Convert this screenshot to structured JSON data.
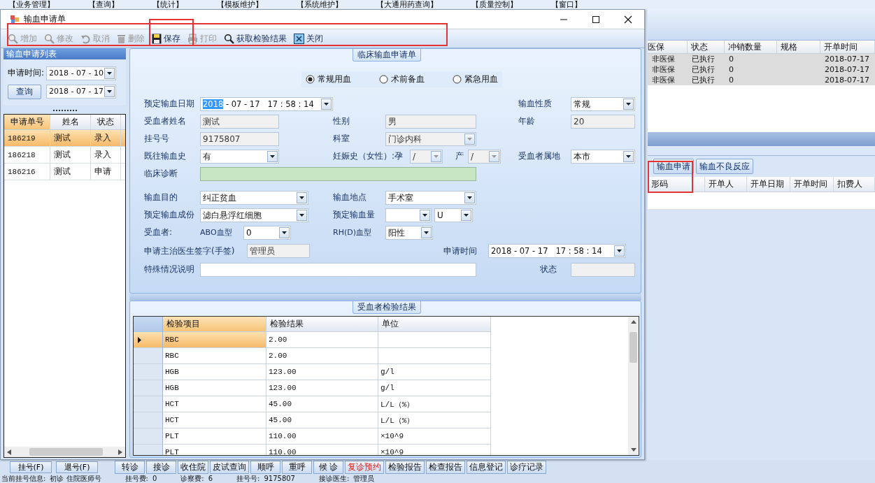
{
  "app": {
    "menu": [
      "【业务管理】",
      "【查询】",
      "【统计】",
      "【模板维护】",
      "【系统维护】",
      "【大通用药查询】",
      "【质量控制】",
      "【窗口】"
    ],
    "orders_table": {
      "columns": [
        "医保",
        "状态",
        "冲销数量",
        "规格",
        "开单时间"
      ],
      "rows": [
        {
          "insurance": "非医保",
          "status": "已执行",
          "writeoff_qty": "0",
          "time": "2018-07-17"
        },
        {
          "insurance": "非医保",
          "status": "已执行",
          "writeoff_qty": "0",
          "time": "2018-07-17"
        },
        {
          "insurance": "非医保",
          "status": "已执行",
          "writeoff_qty": "0",
          "time": "2018-07-17"
        }
      ]
    },
    "tab_buttons": [
      "输血申请",
      "输血不良反应"
    ],
    "detail_table": {
      "columns": [
        "形码",
        "开单人",
        "开单日期",
        "开单时间",
        "扣费人"
      ]
    },
    "left_buttons": [
      "挂号(F)",
      "退号(F)"
    ],
    "action_buttons": [
      {
        "label": "转诊",
        "emphasis": false
      },
      {
        "label": "接诊",
        "emphasis": false
      },
      {
        "label": "收住院",
        "emphasis": false
      },
      {
        "label": "皮试查询",
        "emphasis": false
      },
      {
        "label": "顺呼",
        "emphasis": false
      },
      {
        "label": "重呼",
        "emphasis": false
      },
      {
        "label": "候 诊",
        "emphasis": false
      },
      {
        "label": "复诊预约",
        "emphasis": true
      },
      {
        "label": "检验报告",
        "emphasis": false
      },
      {
        "label": "检查报告",
        "emphasis": false
      },
      {
        "label": "信息登记",
        "emphasis": false
      },
      {
        "label": "诊疗记录",
        "emphasis": false
      }
    ],
    "status_line": [
      {
        "label": "当前挂号信息:",
        "value": "初诊 住院医师号"
      },
      {
        "label": "挂号费:",
        "value": "0"
      },
      {
        "label": "诊察费:",
        "value": "6"
      },
      {
        "label": "挂号号:",
        "value": "9175807"
      },
      {
        "label": "接诊医生:",
        "value": "管理员"
      }
    ]
  },
  "dialog": {
    "title": "输血申请单",
    "toolbar": [
      {
        "label": "增加",
        "disabled": true
      },
      {
        "label": "修改",
        "disabled": true
      },
      {
        "label": "取消",
        "disabled": true
      },
      {
        "label": "删除",
        "disabled": true
      },
      {
        "label": "保存",
        "disabled": false
      },
      {
        "label": "打印",
        "disabled": true
      },
      {
        "label": "获取检验结果",
        "disabled": false
      },
      {
        "label": "关闭",
        "disabled": false
      }
    ],
    "list_panel": {
      "title": "输血申请列表",
      "date_label": "申请时间:",
      "date_from": "2018 - 07 - 10",
      "query_button": "查询",
      "date_to": "2018 - 07 - 17",
      "columns": [
        "申请单号",
        "姓名",
        "状态"
      ],
      "rows": [
        {
          "no": "186219",
          "name": "测试",
          "status": "录入",
          "selected": true
        },
        {
          "no": "186218",
          "name": "测试",
          "status": "录入",
          "selected": false
        },
        {
          "no": "186216",
          "name": "测试",
          "status": "申请",
          "selected": false
        }
      ]
    },
    "form": {
      "title": "临床输血申请单",
      "blood_use": [
        {
          "label": "常规用血",
          "selected": true
        },
        {
          "label": "术前备血",
          "selected": false
        },
        {
          "label": "紧急用血",
          "selected": false
        }
      ],
      "planned_date": {
        "label": "预定输血日期",
        "selected_part": "2018",
        "rest": "- 07 - 17   17 : 58 : 14",
        "disabled": false
      },
      "nature": {
        "label": "输血性质",
        "value": "常规",
        "disabled": false
      },
      "recipient_name": {
        "label": "受血者姓名",
        "value": "测试",
        "disabled": true
      },
      "gender": {
        "label": "性别",
        "value": "男",
        "disabled": true
      },
      "age": {
        "label": "年龄",
        "value": "20",
        "disabled": true
      },
      "registration_no": {
        "label": "挂号号",
        "value": "9175807",
        "disabled": true
      },
      "department": {
        "label": "科室",
        "value": "门诊内科",
        "disabled": true
      },
      "history": {
        "label": "既往输血史",
        "value": "有",
        "disabled": false
      },
      "pregnancy": {
        "label": "妊娠史（女性）:孕",
        "value": "/",
        "disabled": true
      },
      "birth": {
        "label": "产",
        "value": "/",
        "disabled": true
      },
      "residence": {
        "label": "受血者属地",
        "value": "本市",
        "disabled": false
      },
      "diagnosis": {
        "label": "临床诊断",
        "disabled": false,
        "highlighted": true
      },
      "purpose": {
        "label": "输血目的",
        "value": "纠正贫血",
        "disabled": false
      },
      "location": {
        "label": "输血地点",
        "value": "手术室",
        "disabled": false
      },
      "component": {
        "label": "预定输血成份",
        "value": "滤白悬浮红细胞",
        "disabled": false
      },
      "amount": {
        "label": "预定输血量",
        "disabled": false
      },
      "amount_unit": {
        "value": "U",
        "disabled": false
      },
      "recipient": {
        "label": "受血者:"
      },
      "abo": {
        "label": "ABO血型",
        "value": "0",
        "disabled": false
      },
      "rh": {
        "label": "RH(D)血型",
        "value": "阳性",
        "disabled": false
      },
      "doctor": {
        "label": "申请主治医生签字(手签)",
        "value": "管理员",
        "disabled": true
      },
      "apply_time": {
        "label": "申请时间",
        "value": "2018 - 07 - 17   17 : 58 : 14",
        "disabled": false
      },
      "special": {
        "label": "特殊情况说明",
        "disabled": false
      },
      "status": {
        "label": "状态",
        "disabled": true
      }
    },
    "results": {
      "title": "受血者检验结果",
      "columns": [
        "检验项目",
        "检验结果",
        "单位"
      ],
      "rows": [
        {
          "item": "RBC",
          "result": "2.00",
          "selected": true
        },
        {
          "item": "RBC",
          "result": "2.00",
          "selected": false
        },
        {
          "item": "HGB",
          "result": "123.00",
          "unit": "g/l",
          "selected": false
        },
        {
          "item": "HGB",
          "result": "123.00",
          "unit": "g/l",
          "selected": false
        },
        {
          "item": "HCT",
          "result": "45.00",
          "unit": "L/L（%）",
          "selected": false
        },
        {
          "item": "HCT",
          "result": "45.00",
          "unit": "L/L（%）",
          "selected": false
        },
        {
          "item": "PLT",
          "result": "110.00",
          "unit": "×10^9",
          "selected": false
        },
        {
          "item": "PLT",
          "result": "110.00",
          "unit": "×10^9",
          "selected": false
        }
      ]
    }
  }
}
